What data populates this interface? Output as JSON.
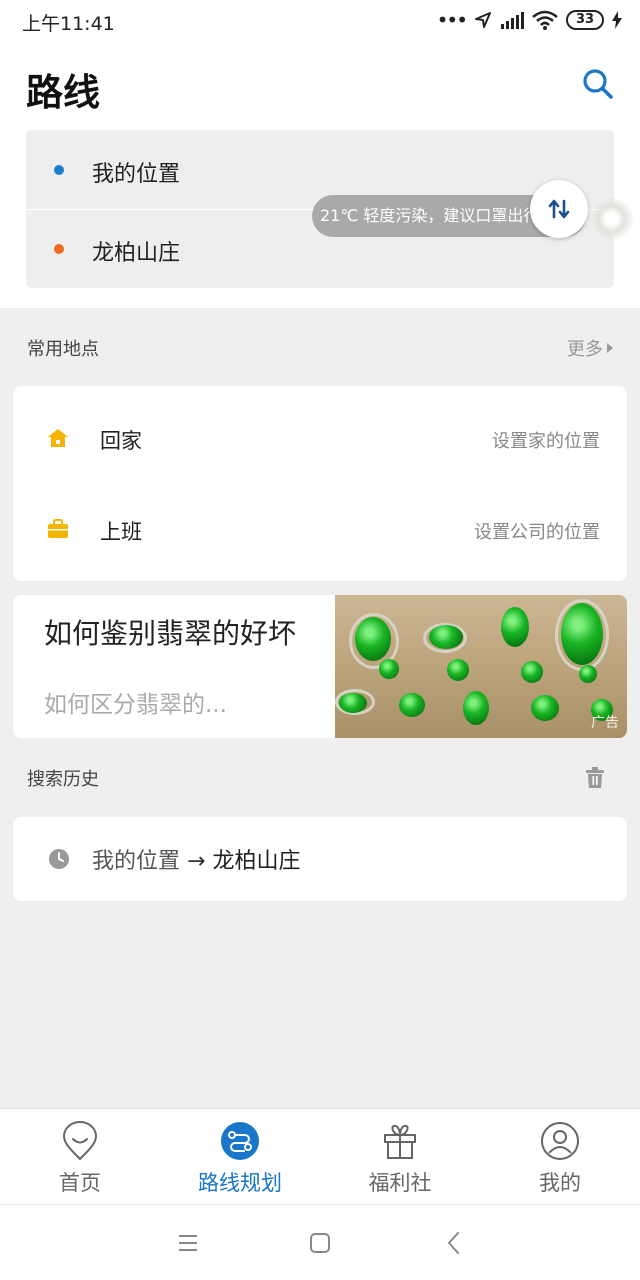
{
  "status_bar": {
    "time": "上午11:41",
    "battery": "33",
    "icons": [
      "more-dots-icon",
      "location-arrow-icon",
      "signal-icon",
      "wifi-icon",
      "battery-icon",
      "charging-bolt-icon"
    ]
  },
  "header": {
    "title": "路线",
    "search_icon": "search-icon"
  },
  "route": {
    "start_label": "我的位置",
    "end_label": "龙柏山庄",
    "start_dot_color": "#1e7fd0",
    "end_dot_color": "#f06a24",
    "swap_icon": "swap-icon"
  },
  "weather": {
    "text": "21℃ 轻度污染，建议口罩出行"
  },
  "favorites": {
    "title": "常用地点",
    "more_label": "更多",
    "items": [
      {
        "icon": "home-icon",
        "name": "回家",
        "hint": "设置家的位置"
      },
      {
        "icon": "briefcase-icon",
        "name": "上班",
        "hint": "设置公司的位置"
      }
    ],
    "icon_color": "#f4b400"
  },
  "ad": {
    "title": "如何鉴别翡翠的好坏",
    "subtitle": "如何区分翡翠的...",
    "tag": "广告"
  },
  "history": {
    "title": "搜索历史",
    "clear_icon": "trash-icon",
    "items": [
      {
        "icon": "clock-icon",
        "from": "我的位置",
        "arrow": "→",
        "to": "龙柏山庄"
      }
    ]
  },
  "tabs": [
    {
      "icon": "home-smile-icon",
      "label": "首页",
      "active": false
    },
    {
      "icon": "route-plan-icon",
      "label": "路线规划",
      "active": true
    },
    {
      "icon": "gift-icon",
      "label": "福利社",
      "active": false
    },
    {
      "icon": "user-icon",
      "label": "我的",
      "active": false
    }
  ],
  "accent_color": "#1976c8",
  "system_nav": [
    "menu-icon",
    "home-square-icon",
    "back-icon"
  ]
}
